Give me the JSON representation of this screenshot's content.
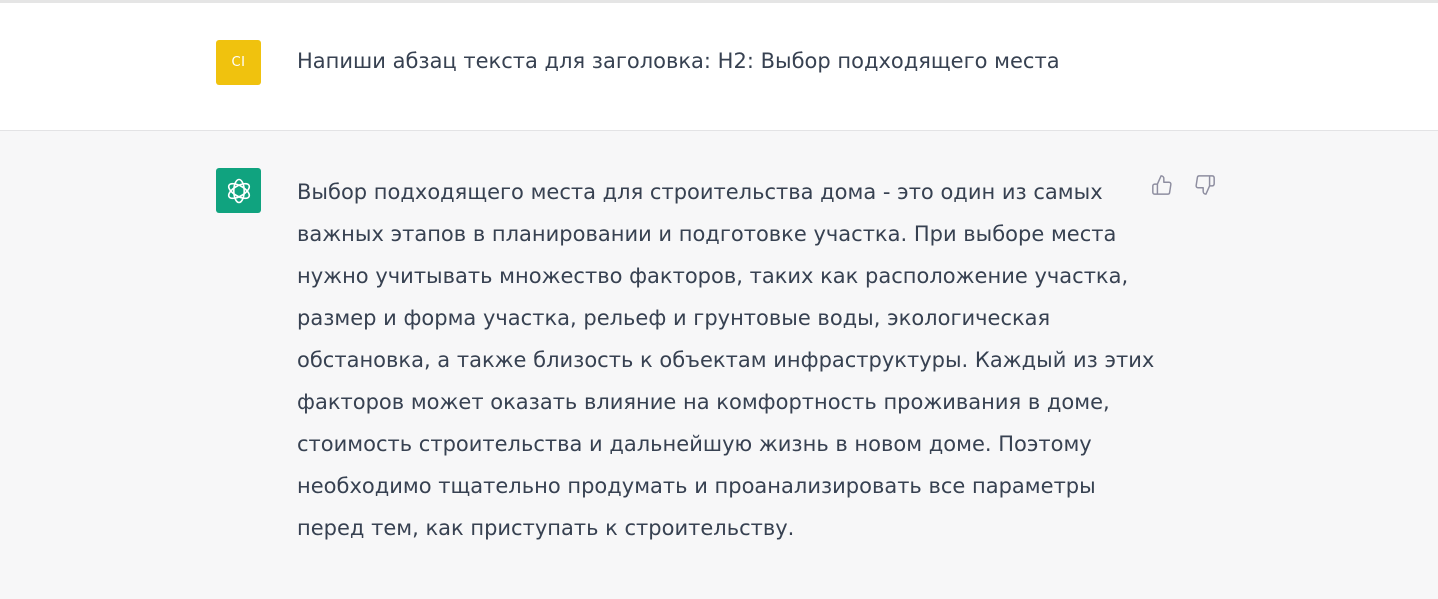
{
  "user_message": {
    "avatar_initials": "CI",
    "avatar_color": "#f0c20e",
    "text": "Напиши абзац текста для заголовка: H2: Выбор подходящего места"
  },
  "assistant_message": {
    "avatar_icon": "openai-logo-icon",
    "avatar_color": "#10a37f",
    "lines": [
      "Выбор подходящего места для строительства дома - это один из самых",
      "важных этапов в планировании и подготовке участка. При выборе места",
      "нужно учитывать множество факторов, таких как расположение участка,",
      "размер и форма участка, рельеф и грунтовые воды, экологическая",
      "обстановка, а также близость к объектам инфраструктуры. Каждый из этих",
      "факторов может оказать влияние на комфортность проживания в доме,",
      "стоимость строительства и дальнейшую жизнь в новом доме. Поэтому",
      "необходимо тщательно продумать и проанализировать все параметры",
      "перед тем, как приступать к строительству."
    ],
    "feedback": {
      "thumbs_up_icon": "thumbs-up-icon",
      "thumbs_down_icon": "thumbs-down-icon"
    }
  }
}
